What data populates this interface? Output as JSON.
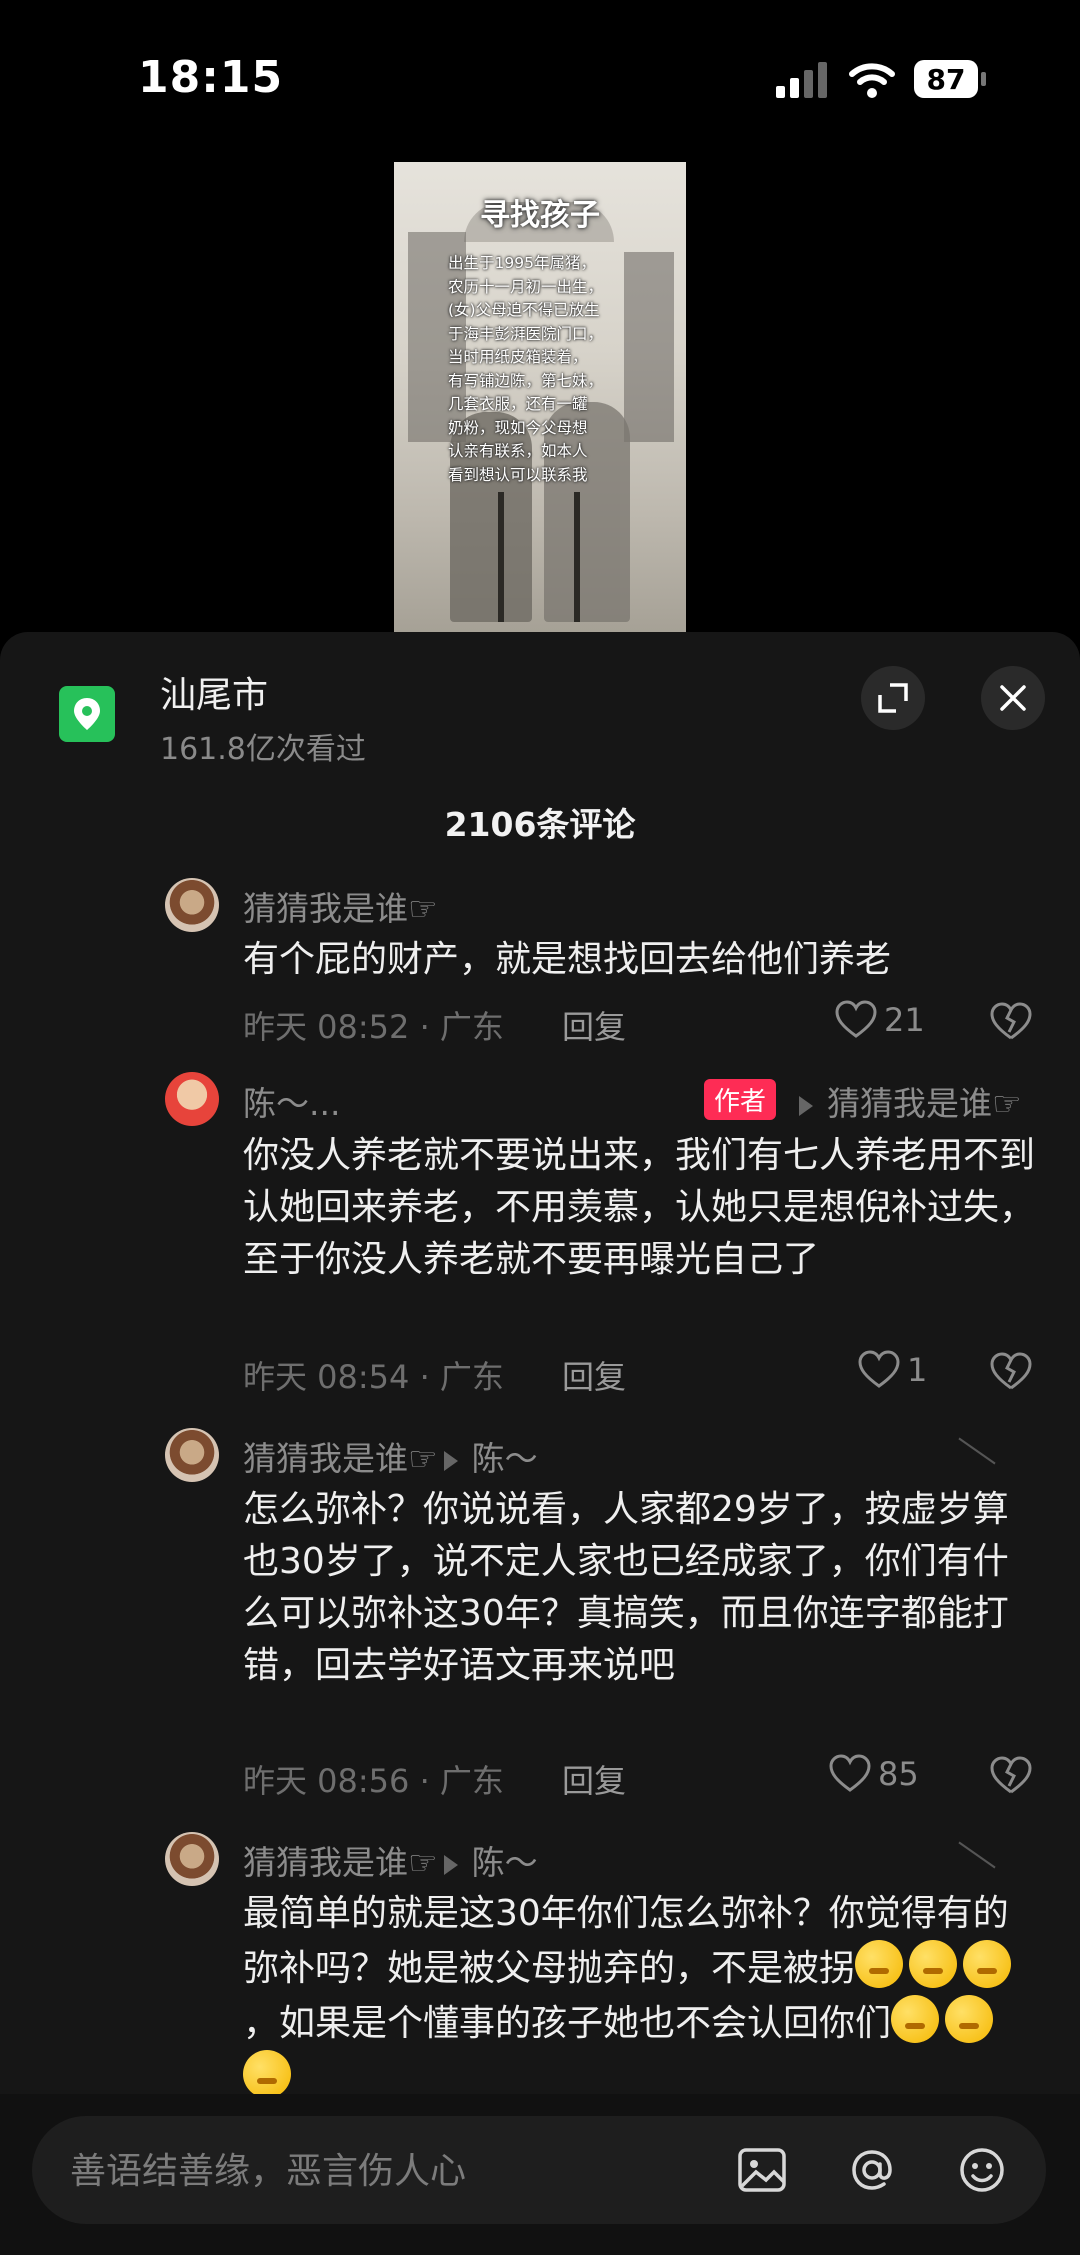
{
  "status_bar": {
    "time": "18:15",
    "battery": "87"
  },
  "poster": {
    "title": "寻找孩子",
    "body": "出生于1995年属猪，\n农历十一月初一出生，\n(女)父母迫不得已放生\n于海丰彭湃医院门口，\n当时用纸皮箱装着，\n有写铺边陈，第七妹，\n几套衣服，还有一罐\n奶粉，现如今父母想\n认亲有联系，如本人\n看到想认可以联系我"
  },
  "location": {
    "title": "汕尾市",
    "views": "161.8亿次看过"
  },
  "comments_header": {
    "count_label": "2106条评论"
  },
  "comments": [
    {
      "name": "猜猜我是谁☞",
      "text": "有个屁的财产，就是想找回去给他们养老",
      "meta": "昨天 08:52 · 广东",
      "reply_label": "回复",
      "likes": "21"
    },
    {
      "name": "陈～...",
      "author_badge": "作者",
      "reply_to": "猜猜我是谁☞",
      "text": "你没人养老就不要说出来，我们有七人养老用不到认她回来养老，不用羡慕，认她只是想倪补过失，至于你没人养老就不要再曝光自己了",
      "meta": "昨天 08:54 · 广东",
      "reply_label": "回复",
      "likes": "1"
    },
    {
      "name": "猜猜我是谁☞",
      "reply_to": "陈～",
      "text": "怎么弥补？你说说看，人家都29岁了，按虚岁算也30岁了，说不定人家也已经成家了，你们有什么可以弥补这30年？真搞笑，而且你连字都能打错，回去学好语文再来说吧",
      "meta": "昨天 08:56 · 广东",
      "reply_label": "回复",
      "likes": "85"
    },
    {
      "name": "猜猜我是谁☞",
      "reply_to": "陈～",
      "text_a": "最简单的就是这30年你们怎么弥补？你觉得有的弥补吗？她是被父母抛弃的，不是被拐",
      "text_b": "，如果是个懂事的孩子她也不会认回你们"
    }
  ],
  "input": {
    "placeholder": "善语结善缘，恶言伤人心"
  },
  "colors": {
    "sheet_bg": "#161616",
    "author_badge": "#fe2c55",
    "location_green": "#27c15a"
  }
}
